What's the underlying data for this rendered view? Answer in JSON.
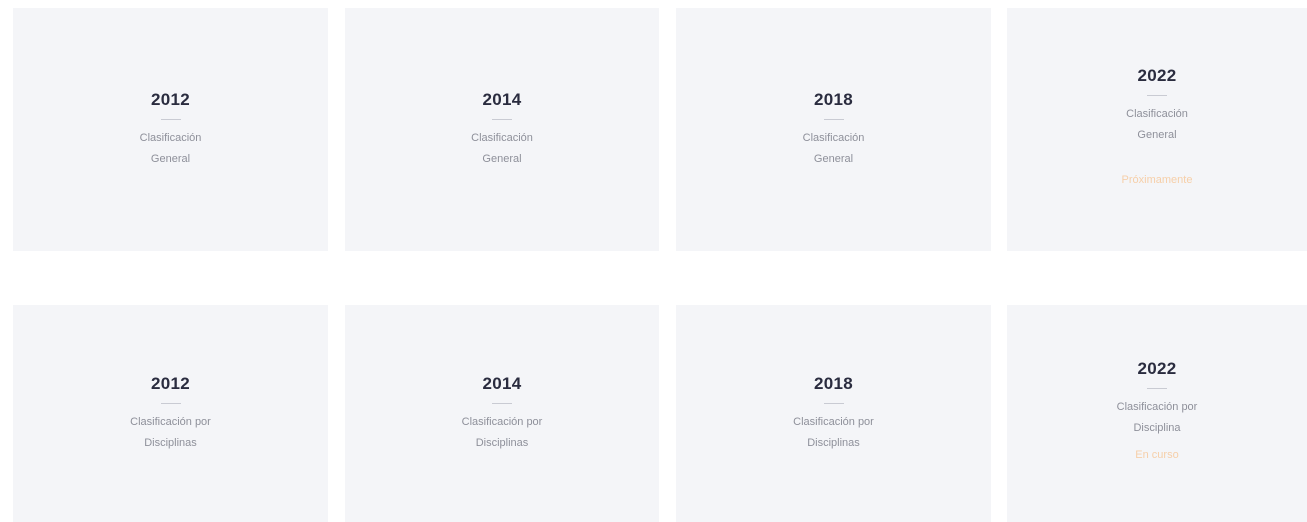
{
  "cards": [
    {
      "year": "2012",
      "description": "Clasificación\nGeneral",
      "status": ""
    },
    {
      "year": "2014",
      "description": "Clasificación\nGeneral",
      "status": ""
    },
    {
      "year": "2018",
      "description": "Clasificación\nGeneral",
      "status": ""
    },
    {
      "year": "2022",
      "description": "Clasificación\nGeneral",
      "status": "Próximamente"
    },
    {
      "year": "2012",
      "description": "Clasificación por\nDisciplinas",
      "status": ""
    },
    {
      "year": "2014",
      "description": "Clasificación por\nDisciplinas",
      "status": ""
    },
    {
      "year": "2018",
      "description": "Clasificación por\nDisciplinas",
      "status": ""
    },
    {
      "year": "2022",
      "description": "Clasificación por\nDisciplina",
      "status": "En curso"
    }
  ],
  "colors": {
    "card_background": "#f4f5f8",
    "year_text": "#2a2c3f",
    "description_text": "#8e909a",
    "status_text": "#f6cfa9"
  }
}
